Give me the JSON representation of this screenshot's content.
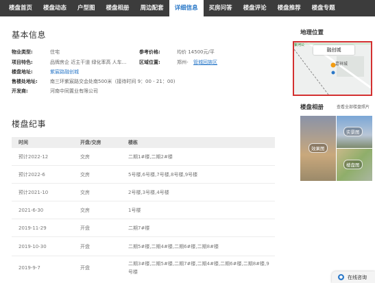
{
  "nav": {
    "items": [
      {
        "label": "楼盘首页"
      },
      {
        "label": "楼盘动态"
      },
      {
        "label": "户型图"
      },
      {
        "label": "楼盘相册"
      },
      {
        "label": "周边配套"
      },
      {
        "label": "详细信息",
        "active": true
      },
      {
        "label": "买房问答"
      },
      {
        "label": "楼盘评论"
      },
      {
        "label": "楼盘推荐"
      },
      {
        "label": "楼盘专题"
      }
    ]
  },
  "basic_info": {
    "title": "基本信息",
    "property_type_label": "物业类型:",
    "property_type": "住宅",
    "features_label": "项目特色:",
    "features": "品牌房企 近主干道 绿化率高 人车...",
    "address_label": "楼盘地址:",
    "address": "紫宸路融创城",
    "sales_address_label": "售楼处地址:",
    "sales_address": "南三环紫宸路交会处南500米（接待时间 9：00 - 21：00)",
    "developer_label": "开发商:",
    "developer": "河南中同置业有限公司",
    "price_label": "参考价格:",
    "price": "均价 14500元/平",
    "location_label": "区域位置:",
    "location_city": "郑州-",
    "location_district": "管城回族区"
  },
  "history": {
    "title": "楼盘纪事",
    "headers": {
      "time": "时间",
      "type": "开盘/交房",
      "buildings": "楼栋"
    },
    "rows": [
      {
        "time": "预计2022-12",
        "type": "交房",
        "buildings": "二期1#楼,二期2#楼"
      },
      {
        "time": "预计2022-6",
        "type": "交房",
        "buildings": "5号楼,6号楼,7号楼,8号楼,9号楼"
      },
      {
        "time": "预计2021-10",
        "type": "交房",
        "buildings": "2号楼,3号楼,4号楼"
      },
      {
        "time": "2021-6-30",
        "type": "交房",
        "buildings": "1号楼"
      },
      {
        "time": "2019-11-29",
        "type": "开盘",
        "buildings": "二期7#楼"
      },
      {
        "time": "2019-10-30",
        "type": "开盘",
        "buildings": "二期5#楼,二期4#楼,二期6#楼,二期8#楼"
      },
      {
        "time": "2019-9-7",
        "type": "开盘",
        "buildings": "二期3#楼,二期5#楼,二期7#楼,二期4#楼,二期6#楼,二期8#楼,9号楼"
      }
    ]
  },
  "sidebar": {
    "location_title": "地理位置",
    "map_label": "融创城",
    "map_poi": "嘉祥城",
    "map_road": "紫河公",
    "album_title": "楼盘相册",
    "album_link": "查看全部楼盘照片",
    "album_tags": {
      "a": "效果图",
      "b": "实景图",
      "c": "楼盘图"
    }
  },
  "consult": {
    "label": "在线咨询"
  },
  "colors": {
    "nav_bg": "#3c3c3c",
    "accent": "#2a78c8",
    "map_border": "#d32f2f"
  }
}
